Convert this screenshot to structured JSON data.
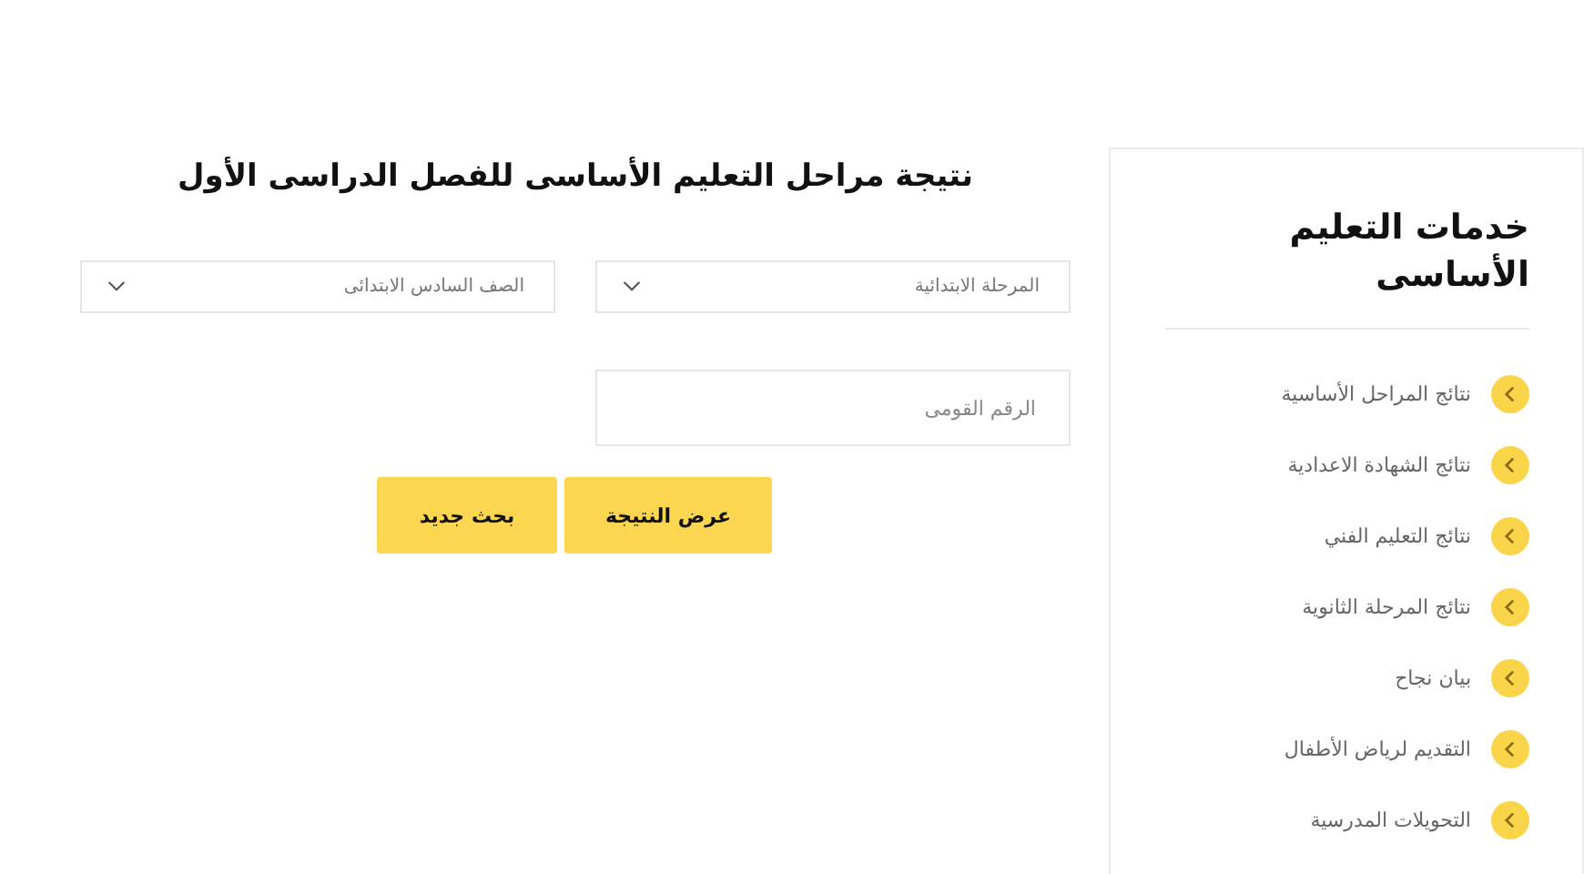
{
  "main": {
    "title": "نتيجة مراحل التعليم الأساسى للفصل الدراسى الأول",
    "selects": [
      {
        "value": "المرحلة الابتدائية"
      },
      {
        "value": "الصف السادس الابتدائى"
      }
    ],
    "national_id": {
      "placeholder": "الرقم القومى"
    },
    "buttons": [
      "عرض النتيجة",
      "بحث جديد"
    ]
  },
  "sidebar": {
    "title": "خدمات التعليم الأساسى",
    "items": [
      "نتائج المراحل الأساسية",
      "نتائج الشهادة الاعدادية",
      "نتائج التعليم الفني",
      "نتائج المرحلة الثانوية",
      "بيان نجاح",
      "التقديم لرياض الأطفال",
      "التحويلات المدرسية"
    ]
  }
}
